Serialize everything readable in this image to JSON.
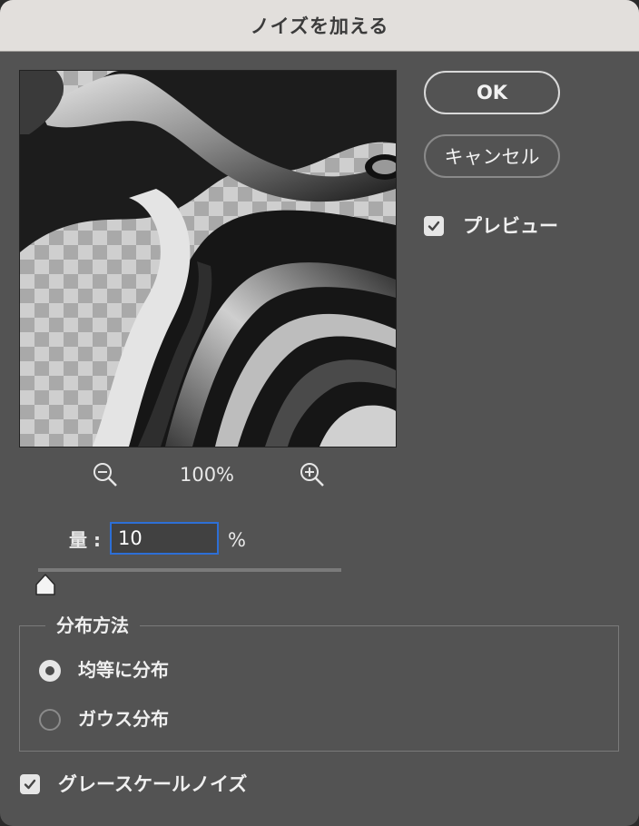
{
  "dialog": {
    "title": "ノイズを加える"
  },
  "buttons": {
    "ok_label": "OK",
    "cancel_label": "キャンセル"
  },
  "preview_checkbox": {
    "label": "プレビュー",
    "checked": true
  },
  "zoom": {
    "level": "100%",
    "zoom_out_icon": "zoom-out-icon",
    "zoom_in_icon": "zoom-in-icon"
  },
  "amount": {
    "label": "量 :",
    "value": "10",
    "unit": "%",
    "slider_fraction": 0.025
  },
  "distribution": {
    "legend": "分布方法",
    "options": [
      {
        "label": "均等に分布",
        "selected": true
      },
      {
        "label": "ガウス分布",
        "selected": false
      }
    ]
  },
  "grayscale_checkbox": {
    "label": "グレースケールノイズ",
    "checked": true
  },
  "colors": {
    "dialog_bg": "#535353",
    "titlebar_bg": "#e2dfdc",
    "focus_accent": "#2d6fd6"
  }
}
